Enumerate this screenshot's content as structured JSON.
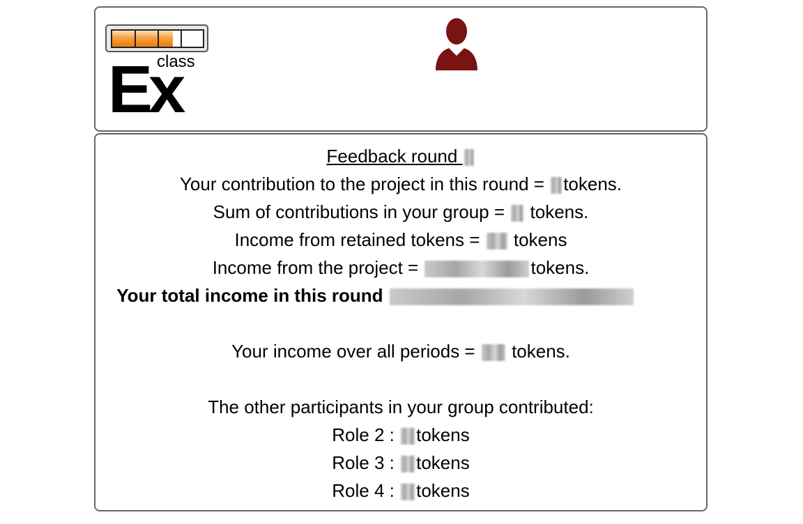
{
  "header": {
    "logo": {
      "wordmark": "Ex",
      "small_text": "class",
      "progress_fraction": 0.67,
      "colors": {
        "bar_fill": "#f59a2e",
        "bar_border": "#222222"
      }
    },
    "user_icon": {
      "icon": "user-icon",
      "color": "#7a1414"
    }
  },
  "feedback": {
    "title": "Feedback round",
    "lines": {
      "contribution": {
        "prefix": "Your contribution to the project in this round =",
        "suffix": "tokens."
      },
      "group_sum": {
        "prefix": "Sum of contributions in your group =",
        "suffix": "tokens."
      },
      "retained": {
        "prefix": "Income from retained tokens =",
        "suffix": "tokens"
      },
      "project_income": {
        "prefix": "Income from the project =",
        "suffix": "tokens."
      },
      "total_income": {
        "prefix": "Your total income in this round"
      },
      "income_all_periods": {
        "prefix": "Your income over all periods =",
        "suffix": "tokens."
      }
    },
    "others_heading": "The other participants in your group contributed:",
    "roles": [
      {
        "label": "Role 2 :",
        "suffix": "tokens"
      },
      {
        "label": "Role 3 :",
        "suffix": "tokens"
      },
      {
        "label": "Role 4 :",
        "suffix": "tokens"
      }
    ]
  }
}
